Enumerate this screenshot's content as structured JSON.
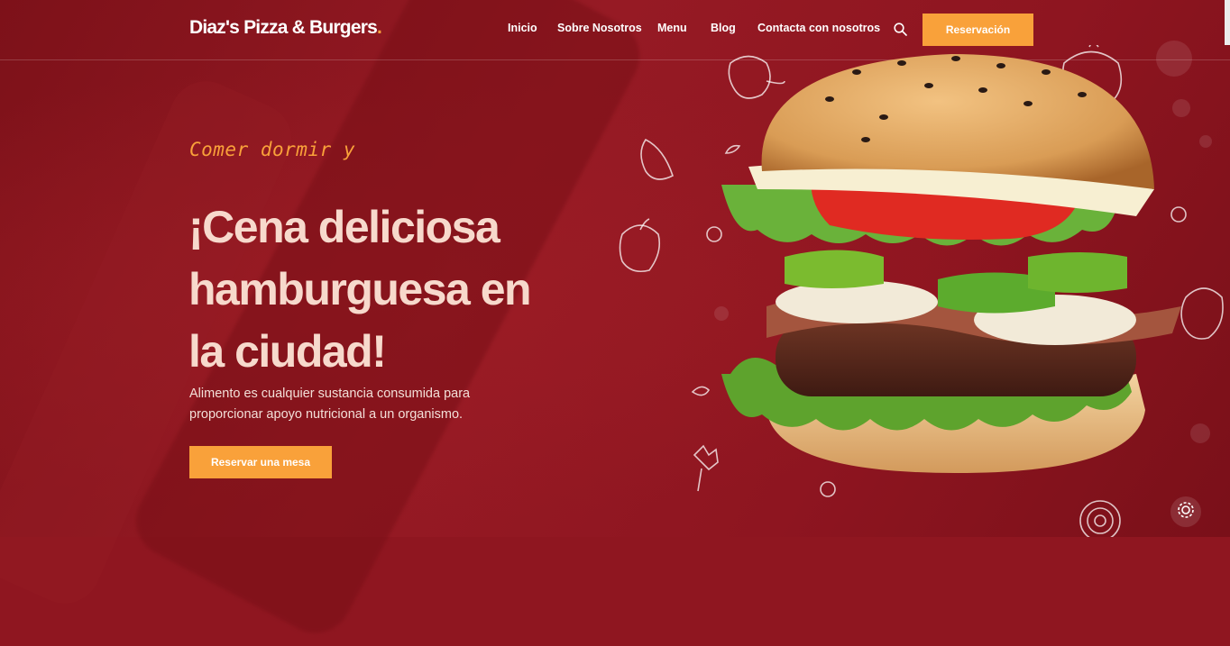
{
  "header": {
    "logo": "Diaz's Pizza & Burgers",
    "logo_dot": ".",
    "nav": [
      "Inicio",
      "Sobre Nosotros",
      "Menu",
      "Blog",
      "Contacta con nosotros"
    ],
    "search_icon": "search-icon",
    "reserve_button": "Reservación"
  },
  "hero": {
    "tagline": "Comer dormir y",
    "headline_line1": "¡Cena deliciosa",
    "headline_line2": "hamburguesa en",
    "headline_line3": "la ciudad!",
    "description": "Alimento es cualquier sustancia consumida para proporcionar apoyo nutricional a un organismo.",
    "cta_button": "Reservar una mesa"
  },
  "floating": {
    "settings_icon": "gear-icon"
  },
  "colors": {
    "background": "#8f1620",
    "accent": "#f9a13a",
    "headline": "#f7d9cc",
    "white": "#ffffff"
  }
}
